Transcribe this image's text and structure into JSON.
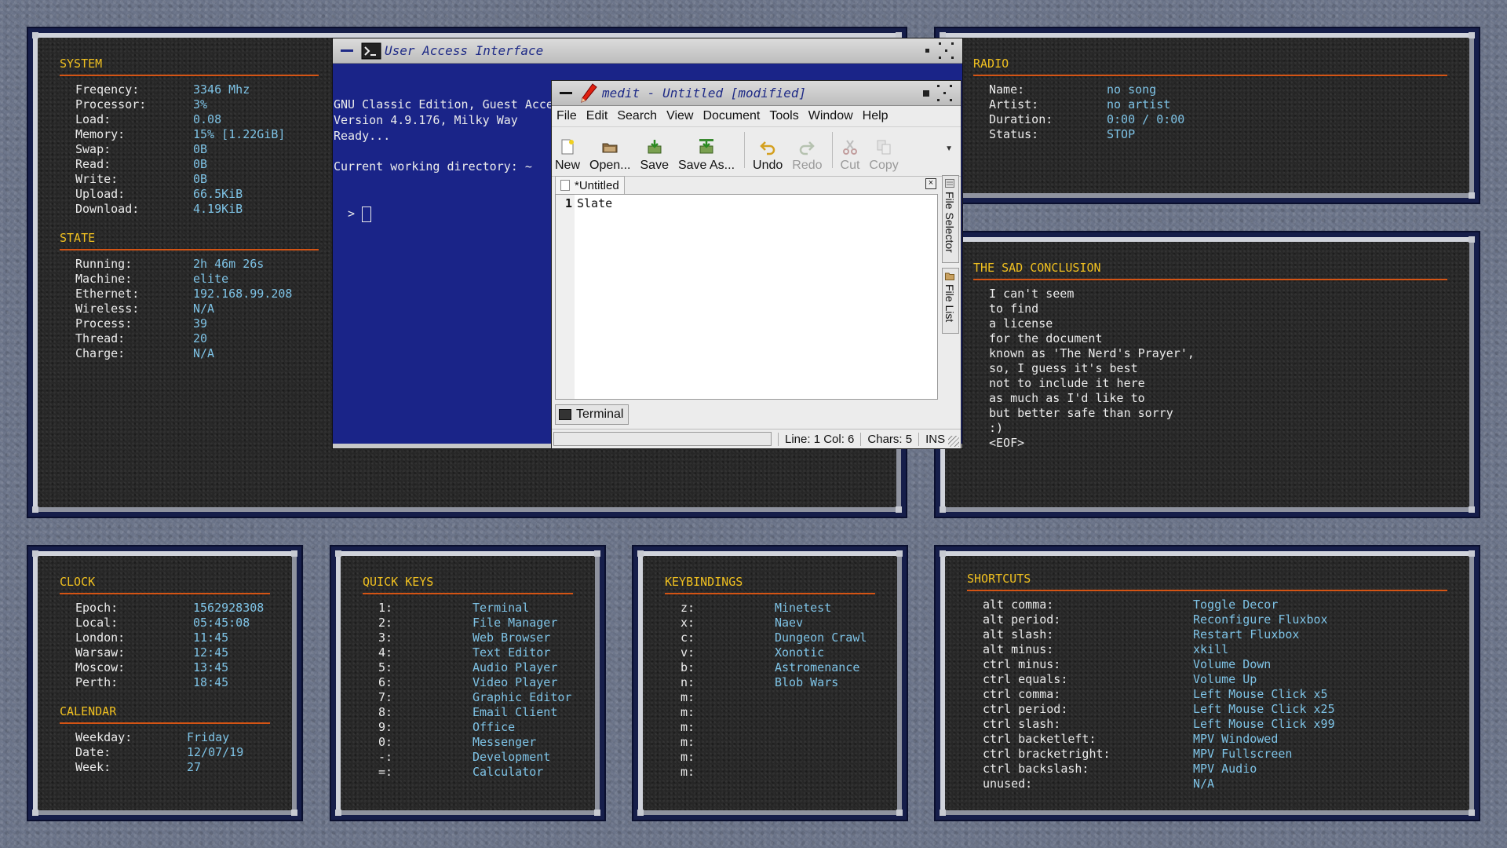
{
  "system": {
    "title": "SYSTEM",
    "rows": [
      {
        "k": "Freqency:",
        "v": "3346 Mhz"
      },
      {
        "k": "Processor:",
        "v": "3%"
      },
      {
        "k": "Load:",
        "v": "0.08"
      },
      {
        "k": "Memory:",
        "v": "15% [1.22GiB]"
      },
      {
        "k": "Swap:",
        "v": "0B"
      },
      {
        "k": "Read:",
        "v": "0B"
      },
      {
        "k": "Write:",
        "v": "0B"
      },
      {
        "k": "Upload:",
        "v": "66.5KiB"
      },
      {
        "k": "Download:",
        "v": "4.19KiB"
      }
    ]
  },
  "state": {
    "title": "STATE",
    "rows": [
      {
        "k": "Running:",
        "v": "2h 46m 26s"
      },
      {
        "k": "Machine:",
        "v": "elite"
      },
      {
        "k": "Ethernet:",
        "v": "192.168.99.208"
      },
      {
        "k": "Wireless:",
        "v": "N/A"
      },
      {
        "k": "Process:",
        "v": "39"
      },
      {
        "k": "Thread:",
        "v": "20"
      },
      {
        "k": "Charge:",
        "v": "N/A"
      }
    ]
  },
  "radio": {
    "title": "RADIO",
    "rows": [
      {
        "k": "Name:",
        "v": "no song"
      },
      {
        "k": "Artist:",
        "v": "no artist"
      },
      {
        "k": "Duration:",
        "v": "0:00 / 0:00"
      },
      {
        "k": "Status:",
        "v": "STOP"
      }
    ]
  },
  "conclusion": {
    "title": "THE SAD CONCLUSION",
    "lines": [
      "I can't seem",
      "to find",
      "a license",
      "for the document",
      "known as 'The Nerd's Prayer',",
      "so, I guess it's best",
      "not to include it here",
      "as much as I'd like to",
      "but better safe than sorry",
      ":)",
      "<EOF>"
    ]
  },
  "clock": {
    "title": "CLOCK",
    "rows": [
      {
        "k": "Epoch:",
        "v": "1562928308"
      },
      {
        "k": "Local:",
        "v": "05:45:08"
      },
      {
        "k": "London:",
        "v": "11:45"
      },
      {
        "k": "Warsaw:",
        "v": "12:45"
      },
      {
        "k": "Moscow:",
        "v": "13:45"
      },
      {
        "k": "Perth:",
        "v": "18:45"
      }
    ]
  },
  "calendar": {
    "title": "CALENDAR",
    "rows": [
      {
        "k": "Weekday:",
        "v": "Friday"
      },
      {
        "k": "Date:",
        "v": "12/07/19"
      },
      {
        "k": "Week:",
        "v": "27"
      }
    ]
  },
  "quickkeys": {
    "title": "QUICK KEYS",
    "rows": [
      {
        "k": "1:",
        "v": "Terminal"
      },
      {
        "k": "2:",
        "v": "File Manager"
      },
      {
        "k": "3:",
        "v": "Web Browser"
      },
      {
        "k": "4:",
        "v": "Text Editor"
      },
      {
        "k": "5:",
        "v": "Audio Player"
      },
      {
        "k": "6:",
        "v": "Video Player"
      },
      {
        "k": "7:",
        "v": "Graphic Editor"
      },
      {
        "k": "8:",
        "v": "Email Client"
      },
      {
        "k": "9:",
        "v": "Office"
      },
      {
        "k": "0:",
        "v": "Messenger"
      },
      {
        "k": "-:",
        "v": "Development"
      },
      {
        "k": "=:",
        "v": "Calculator"
      }
    ]
  },
  "keybindings": {
    "title": "KEYBINDINGS",
    "rows": [
      {
        "k": "z:",
        "v": "Minetest"
      },
      {
        "k": "x:",
        "v": "Naev"
      },
      {
        "k": "c:",
        "v": "Dungeon Crawl"
      },
      {
        "k": "v:",
        "v": "Xonotic"
      },
      {
        "k": "b:",
        "v": "Astromenance"
      },
      {
        "k": "n:",
        "v": "Blob Wars"
      },
      {
        "k": "m:",
        "v": ""
      },
      {
        "k": "m:",
        "v": ""
      },
      {
        "k": "m:",
        "v": ""
      },
      {
        "k": "m:",
        "v": ""
      },
      {
        "k": "m:",
        "v": ""
      },
      {
        "k": "m:",
        "v": ""
      }
    ]
  },
  "shortcuts": {
    "title": "SHORTCUTS",
    "rows": [
      {
        "k": "alt comma:",
        "v": "Toggle Decor"
      },
      {
        "k": "alt period:",
        "v": "Reconfigure Fluxbox"
      },
      {
        "k": "alt slash:",
        "v": "Restart Fluxbox"
      },
      {
        "k": "alt minus:",
        "v": "xkill"
      },
      {
        "k": "ctrl minus:",
        "v": "Volume Down"
      },
      {
        "k": "ctrl equals:",
        "v": "Volume Up"
      },
      {
        "k": "ctrl comma:",
        "v": "Left Mouse Click x5"
      },
      {
        "k": "ctrl period:",
        "v": "Left Mouse Click x25"
      },
      {
        "k": "ctrl slash:",
        "v": "Left Mouse Click x99"
      },
      {
        "k": "ctrl backetleft:",
        "v": "MPV Windowed"
      },
      {
        "k": "ctrl bracketright:",
        "v": "MPV Fullscreen"
      },
      {
        "k": "ctrl backslash:",
        "v": "MPV Audio"
      },
      {
        "k": "unused:",
        "v": "N/A"
      }
    ]
  },
  "terminal": {
    "title": "User Access Interface",
    "lines": [
      "GNU Classic Edition, Guest Access Interface",
      "Version 4.9.176, Milky Way",
      "Ready...",
      "",
      "Current working directory: ~"
    ],
    "prompt": "  > "
  },
  "medit": {
    "title": "medit - Untitled [modified]",
    "menu": [
      "File",
      "Edit",
      "Search",
      "View",
      "Document",
      "Tools",
      "Window",
      "Help"
    ],
    "toolbar": [
      {
        "label": "New",
        "icon": "new-document-icon",
        "disabled": false
      },
      {
        "label": "Open...",
        "icon": "open-folder-icon",
        "disabled": false
      },
      {
        "label": "Save",
        "icon": "save-icon",
        "disabled": false
      },
      {
        "label": "Save As...",
        "icon": "save-as-icon",
        "disabled": false
      },
      {
        "label": "Undo",
        "icon": "undo-icon",
        "disabled": false
      },
      {
        "label": "Redo",
        "icon": "redo-icon",
        "disabled": true
      },
      {
        "label": "Cut",
        "icon": "cut-icon",
        "disabled": true
      },
      {
        "label": "Copy",
        "icon": "copy-icon",
        "disabled": true
      }
    ],
    "tab_label": "*Untitled",
    "line_number": "1",
    "content": "Slate",
    "side_tabs": [
      "File Selector",
      "File List"
    ],
    "terminal_tab": "Terminal",
    "status": {
      "position": "Line: 1 Col: 6",
      "chars": "Chars: 5",
      "mode": "INS"
    }
  },
  "colors": {
    "heading": "#f0c020",
    "rule": "#d45414",
    "value": "#7ec3e6",
    "terminal_bg": "#1a2488"
  }
}
